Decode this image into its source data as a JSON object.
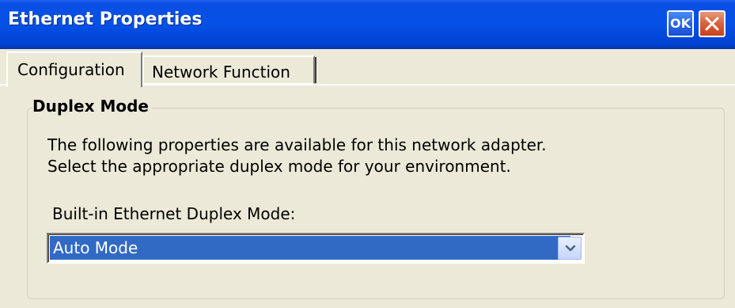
{
  "window": {
    "title": "Ethernet Properties",
    "ok_label": "OK",
    "close_icon": "close-icon"
  },
  "tabs": [
    {
      "label": "Configuration",
      "active": true
    },
    {
      "label": "Network Function",
      "active": false
    }
  ],
  "group": {
    "title": "Duplex Mode",
    "description_line1": "The following properties are available for this network adapter.",
    "description_line2": "Select the appropriate duplex mode for your environment.",
    "combo_label": "Built-in Ethernet Duplex Mode:",
    "combo_value": "Auto Mode",
    "combo_icon": "chevron-down-icon"
  },
  "colors": {
    "titlebar": "#0550e6",
    "selection": "#316ac5",
    "window_bg": "#ece9d8",
    "close_button": "#d9603c"
  }
}
